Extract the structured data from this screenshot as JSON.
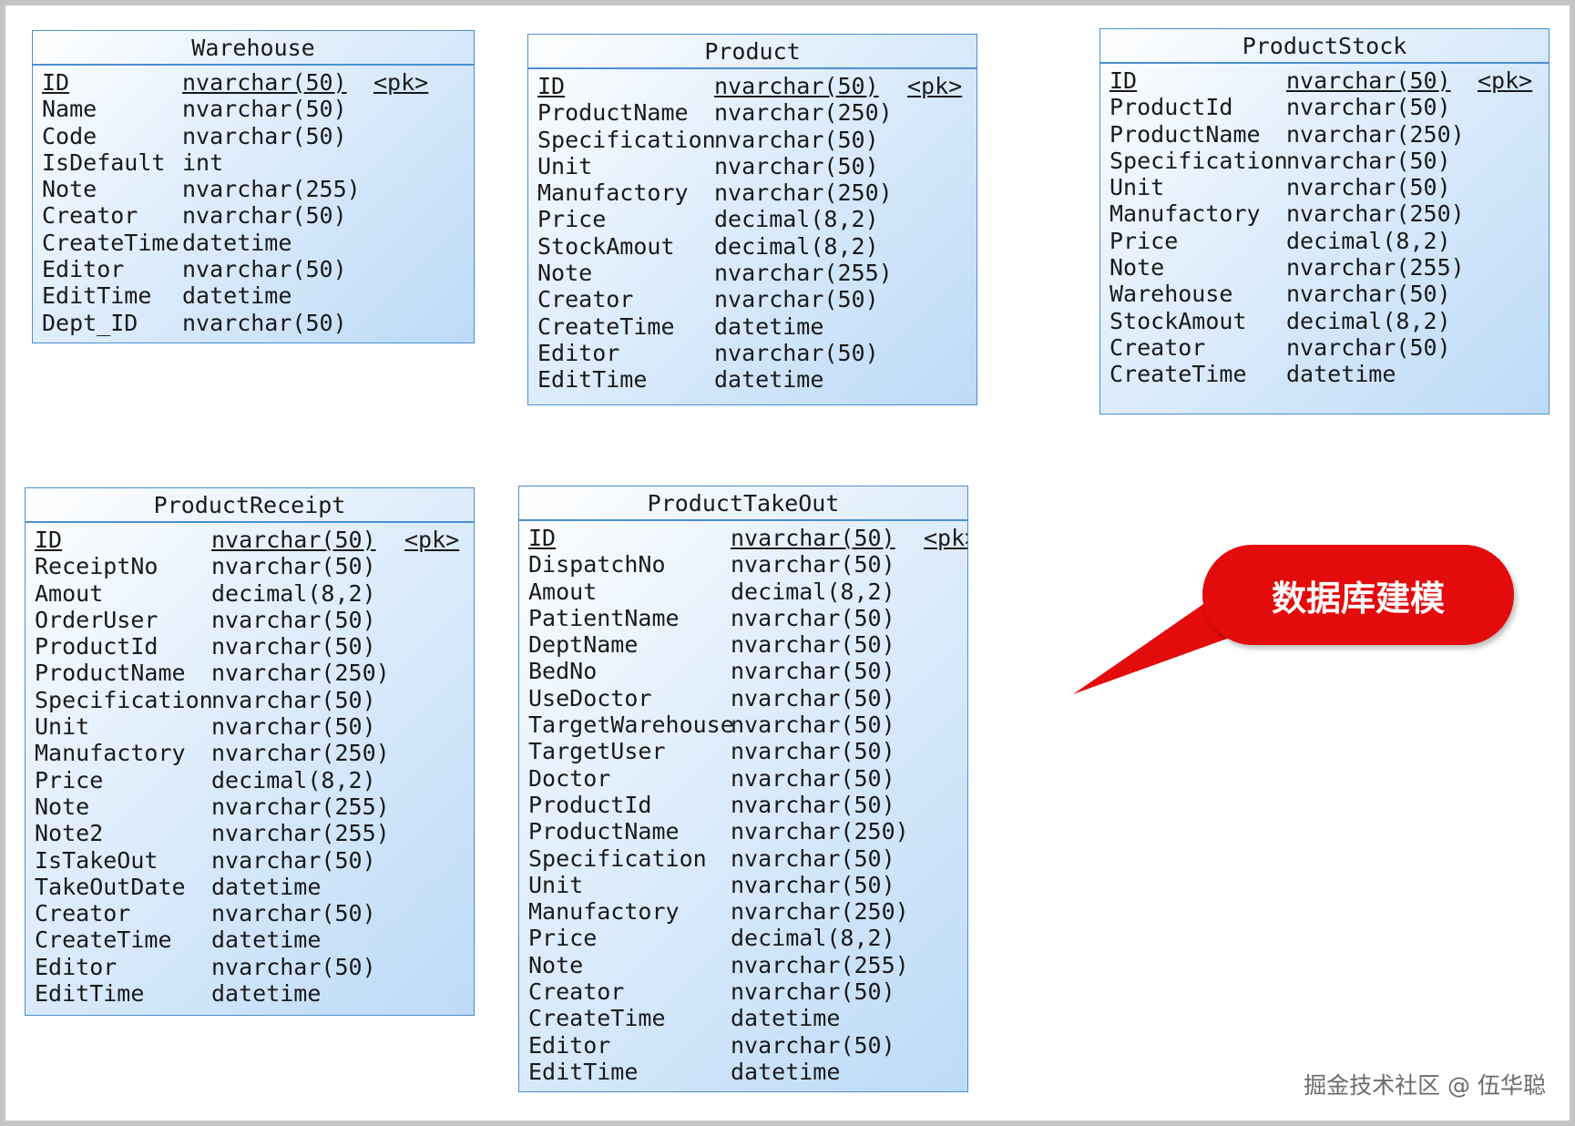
{
  "tables": [
    {
      "title": "Warehouse",
      "columns": [
        {
          "name": "ID",
          "type": "nvarchar(50)",
          "key": "<pk>",
          "pk": true
        },
        {
          "name": "Name",
          "type": "nvarchar(50)",
          "key": ""
        },
        {
          "name": "Code",
          "type": "nvarchar(50)",
          "key": ""
        },
        {
          "name": "IsDefault",
          "type": "int",
          "key": ""
        },
        {
          "name": "Note",
          "type": "nvarchar(255)",
          "key": ""
        },
        {
          "name": "Creator",
          "type": "nvarchar(50)",
          "key": ""
        },
        {
          "name": "CreateTime",
          "type": "datetime",
          "key": ""
        },
        {
          "name": "Editor",
          "type": "nvarchar(50)",
          "key": ""
        },
        {
          "name": "EditTime",
          "type": "datetime",
          "key": ""
        },
        {
          "name": "Dept_ID",
          "type": "nvarchar(50)",
          "key": ""
        }
      ]
    },
    {
      "title": "Product",
      "columns": [
        {
          "name": "ID",
          "type": "nvarchar(50)",
          "key": "<pk>",
          "pk": true
        },
        {
          "name": "ProductName",
          "type": "nvarchar(250)",
          "key": ""
        },
        {
          "name": "Specification",
          "type": "nvarchar(50)",
          "key": ""
        },
        {
          "name": "Unit",
          "type": "nvarchar(50)",
          "key": ""
        },
        {
          "name": "Manufactory",
          "type": "nvarchar(250)",
          "key": ""
        },
        {
          "name": "Price",
          "type": "decimal(8,2)",
          "key": ""
        },
        {
          "name": "StockAmout",
          "type": "decimal(8,2)",
          "key": ""
        },
        {
          "name": "Note",
          "type": "nvarchar(255)",
          "key": ""
        },
        {
          "name": "Creator",
          "type": "nvarchar(50)",
          "key": ""
        },
        {
          "name": "CreateTime",
          "type": "datetime",
          "key": ""
        },
        {
          "name": "Editor",
          "type": "nvarchar(50)",
          "key": ""
        },
        {
          "name": "EditTime",
          "type": "datetime",
          "key": ""
        }
      ]
    },
    {
      "title": "ProductStock",
      "columns": [
        {
          "name": "ID",
          "type": "nvarchar(50)",
          "key": "<pk>",
          "pk": true
        },
        {
          "name": "ProductId",
          "type": "nvarchar(50)",
          "key": ""
        },
        {
          "name": "ProductName",
          "type": "nvarchar(250)",
          "key": ""
        },
        {
          "name": "Specification",
          "type": "nvarchar(50)",
          "key": ""
        },
        {
          "name": "Unit",
          "type": "nvarchar(50)",
          "key": ""
        },
        {
          "name": "Manufactory",
          "type": "nvarchar(250)",
          "key": ""
        },
        {
          "name": "Price",
          "type": "decimal(8,2)",
          "key": ""
        },
        {
          "name": "Note",
          "type": "nvarchar(255)",
          "key": ""
        },
        {
          "name": "Warehouse",
          "type": "nvarchar(50)",
          "key": ""
        },
        {
          "name": "StockAmout",
          "type": "decimal(8,2)",
          "key": ""
        },
        {
          "name": "Creator",
          "type": "nvarchar(50)",
          "key": ""
        },
        {
          "name": "CreateTime",
          "type": "datetime",
          "key": ""
        }
      ]
    },
    {
      "title": "ProductReceipt",
      "columns": [
        {
          "name": "ID",
          "type": "nvarchar(50)",
          "key": "<pk>",
          "pk": true
        },
        {
          "name": "ReceiptNo",
          "type": "nvarchar(50)",
          "key": ""
        },
        {
          "name": "Amout",
          "type": "decimal(8,2)",
          "key": ""
        },
        {
          "name": "OrderUser",
          "type": "nvarchar(50)",
          "key": ""
        },
        {
          "name": "ProductId",
          "type": "nvarchar(50)",
          "key": ""
        },
        {
          "name": "ProductName",
          "type": "nvarchar(250)",
          "key": ""
        },
        {
          "name": "Specification",
          "type": "nvarchar(50)",
          "key": ""
        },
        {
          "name": "Unit",
          "type": "nvarchar(50)",
          "key": ""
        },
        {
          "name": "Manufactory",
          "type": "nvarchar(250)",
          "key": ""
        },
        {
          "name": "Price",
          "type": "decimal(8,2)",
          "key": ""
        },
        {
          "name": "Note",
          "type": "nvarchar(255)",
          "key": ""
        },
        {
          "name": "Note2",
          "type": "nvarchar(255)",
          "key": ""
        },
        {
          "name": "IsTakeOut",
          "type": "nvarchar(50)",
          "key": ""
        },
        {
          "name": "TakeOutDate",
          "type": "datetime",
          "key": ""
        },
        {
          "name": "Creator",
          "type": "nvarchar(50)",
          "key": ""
        },
        {
          "name": "CreateTime",
          "type": "datetime",
          "key": ""
        },
        {
          "name": "Editor",
          "type": "nvarchar(50)",
          "key": ""
        },
        {
          "name": "EditTime",
          "type": "datetime",
          "key": ""
        }
      ]
    },
    {
      "title": "ProductTakeOut",
      "columns": [
        {
          "name": "ID",
          "type": "nvarchar(50)",
          "key": "<pk>",
          "pk": true
        },
        {
          "name": "DispatchNo",
          "type": "nvarchar(50)",
          "key": ""
        },
        {
          "name": "Amout",
          "type": "decimal(8,2)",
          "key": ""
        },
        {
          "name": "PatientName",
          "type": "nvarchar(50)",
          "key": ""
        },
        {
          "name": "DeptName",
          "type": "nvarchar(50)",
          "key": ""
        },
        {
          "name": "BedNo",
          "type": "nvarchar(50)",
          "key": ""
        },
        {
          "name": "UseDoctor",
          "type": "nvarchar(50)",
          "key": ""
        },
        {
          "name": "TargetWarehouse",
          "type": "nvarchar(50)",
          "key": ""
        },
        {
          "name": "TargetUser",
          "type": "nvarchar(50)",
          "key": ""
        },
        {
          "name": "Doctor",
          "type": "nvarchar(50)",
          "key": ""
        },
        {
          "name": "ProductId",
          "type": "nvarchar(50)",
          "key": ""
        },
        {
          "name": "ProductName",
          "type": "nvarchar(250)",
          "key": ""
        },
        {
          "name": "Specification",
          "type": "nvarchar(50)",
          "key": ""
        },
        {
          "name": "Unit",
          "type": "nvarchar(50)",
          "key": ""
        },
        {
          "name": "Manufactory",
          "type": "nvarchar(250)",
          "key": ""
        },
        {
          "name": "Price",
          "type": "decimal(8,2)",
          "key": ""
        },
        {
          "name": "Note",
          "type": "nvarchar(255)",
          "key": ""
        },
        {
          "name": "Creator",
          "type": "nvarchar(50)",
          "key": ""
        },
        {
          "name": "CreateTime",
          "type": "datetime",
          "key": ""
        },
        {
          "name": "Editor",
          "type": "nvarchar(50)",
          "key": ""
        },
        {
          "name": "EditTime",
          "type": "datetime",
          "key": ""
        }
      ]
    }
  ],
  "callout": {
    "text": "数据库建模",
    "color": "#e30b0b"
  },
  "watermark": "掘金技术社区 @ 伍华聪",
  "colors": {
    "table_border": "#4b8fd0",
    "table_fill_start": "#ffffff",
    "table_fill_end": "#bcdaf7"
  }
}
